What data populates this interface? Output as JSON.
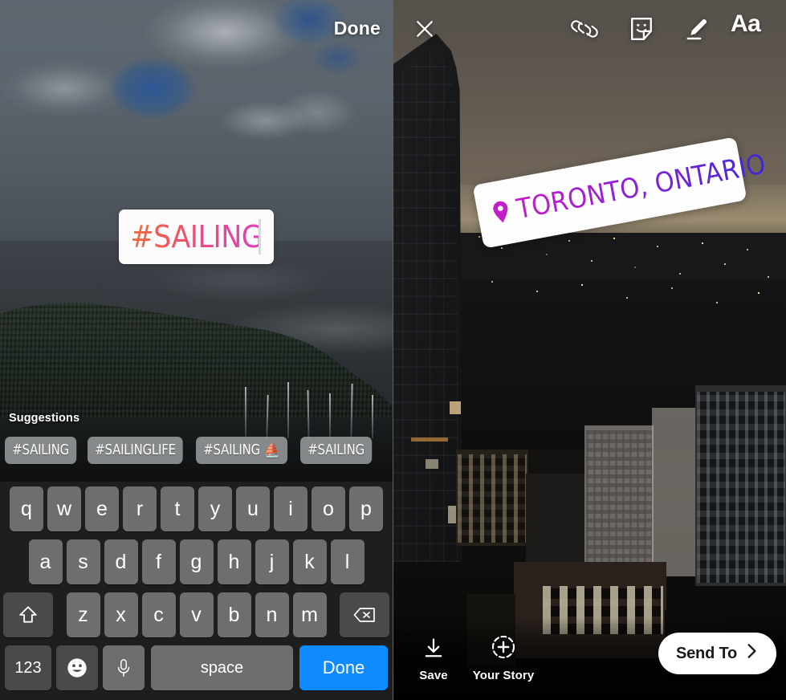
{
  "left_panel": {
    "name": "instagram-story-hashtag-editor",
    "top_bar": {
      "done_label": "Done"
    },
    "hashtag_sticker": {
      "text": "#SAILING",
      "gradient_from": "#f26a3a",
      "gradient_to": "#e13fb8"
    },
    "suggestions": {
      "heading": "Suggestions",
      "items": [
        {
          "label": "#SAILING"
        },
        {
          "label": "#SAILINGLIFE"
        },
        {
          "label": "#SAILING ⛵"
        },
        {
          "label": "#SAILING"
        }
      ]
    },
    "keyboard": {
      "row1": [
        "q",
        "w",
        "e",
        "r",
        "t",
        "y",
        "u",
        "i",
        "o",
        "p"
      ],
      "row2": [
        "a",
        "s",
        "d",
        "f",
        "g",
        "h",
        "j",
        "k",
        "l"
      ],
      "row3": [
        "z",
        "x",
        "c",
        "v",
        "b",
        "n",
        "m"
      ],
      "shift_key": "shift-icon",
      "backspace_key": "backspace-icon",
      "numbers_key": "123",
      "emoji_key": "emoji-icon",
      "mic_key": "microphone-icon",
      "space_key": "space",
      "return_key": "Done",
      "return_key_color": "#0f8aff"
    }
  },
  "right_panel": {
    "name": "instagram-story-share-screen",
    "toolbar": {
      "close": "close-icon",
      "link": "link-icon",
      "sticker": "sticker-icon",
      "draw": "draw-marker-icon",
      "text": "Aa"
    },
    "location_sticker": {
      "text": "TORONTO, ONTARIO",
      "pin_icon": "location-pin-icon",
      "gradient_from": "#c21fc8",
      "gradient_to": "#3c28d4",
      "rotation_deg": -10.5
    },
    "bottom_bar": {
      "save": {
        "label": "Save",
        "icon": "download-arrow-icon"
      },
      "your_story": {
        "label": "Your Story",
        "icon": "add-to-story-icon"
      },
      "send_to": {
        "label": "Send To",
        "icon": "chevron-right-icon"
      }
    }
  }
}
